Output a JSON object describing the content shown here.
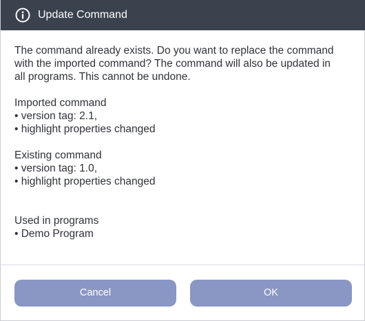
{
  "dialog": {
    "title": "Update Command",
    "icon": "info-icon",
    "colors": {
      "titlebar": "#3a424e",
      "button": "#8a96c3",
      "text": "#2f3238"
    },
    "message_lines": [
      "The command already exists. Do you want to replace the command",
      "with the imported command? The command will also be updated in",
      "all programs. This cannot be undone."
    ],
    "imported": {
      "heading": "Imported command",
      "items": [
        "• version tag: 2.1,",
        "• highlight properties changed"
      ]
    },
    "existing": {
      "heading": "Existing command",
      "items": [
        "• version tag: 1.0,",
        "• highlight properties changed"
      ]
    },
    "used_in": {
      "heading": "Used in programs",
      "items": [
        "• Demo Program"
      ]
    },
    "buttons": {
      "cancel_label": "Cancel",
      "ok_label": "OK"
    }
  }
}
